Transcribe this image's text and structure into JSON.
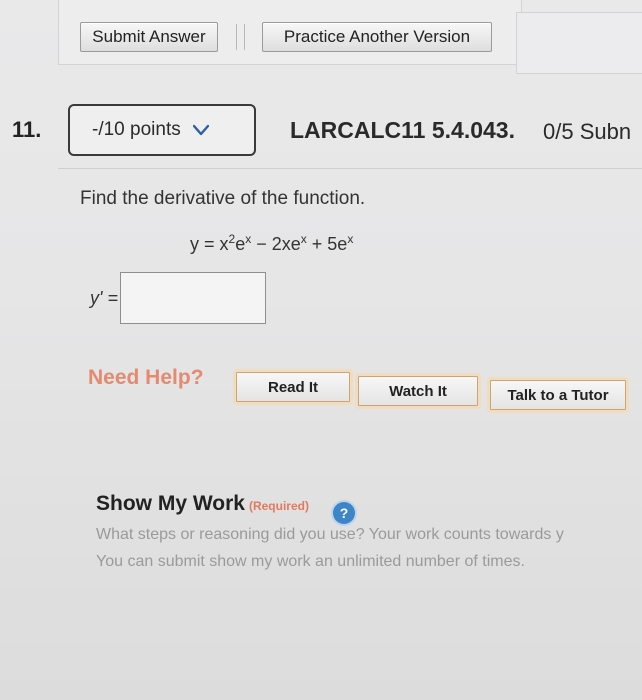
{
  "toolbar": {
    "submit_label": "Submit Answer",
    "practice_label": "Practice Another Version"
  },
  "question": {
    "number": "11.",
    "points": "-/10 points",
    "code": "LARCALC11 5.4.043.",
    "score": "0/5 Subn",
    "prompt": "Find the derivative of the function.",
    "equation": {
      "lhs": "y = x",
      "exp1": "2",
      "term1b": "e",
      "exp2": "x",
      "term2": " − 2xe",
      "exp3": "x",
      "term3": " + 5e",
      "exp4": "x"
    },
    "answer_label": "y' =",
    "answer_value": ""
  },
  "help": {
    "title": "Need Help?",
    "read_it": "Read It",
    "watch_it": "Watch It",
    "tutor": "Talk to a Tutor"
  },
  "show_my_work": {
    "title": "Show My Work",
    "required": "(Required)",
    "help_icon_text": "?",
    "line1": "What steps or reasoning did you use? Your work counts towards y",
    "line2": "You can submit show my work an unlimited number of times."
  },
  "colors": {
    "need_help": "#e38a6f",
    "required": "#e07a5f",
    "help_icon": "#3d85c6"
  }
}
